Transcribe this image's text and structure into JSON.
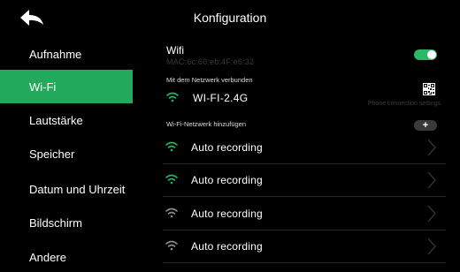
{
  "header": {
    "title": "Konfiguration",
    "back_icon": "back-arrow-icon"
  },
  "sidebar": {
    "items": [
      {
        "label": "Aufnahme",
        "active": false
      },
      {
        "label": "Wi-Fi",
        "active": true
      },
      {
        "label": "Lautstärke",
        "active": false
      },
      {
        "label": "Speicher",
        "active": false
      },
      {
        "label": "Datum und Uhrzeit",
        "active": false
      },
      {
        "label": "Bildschirm",
        "active": false
      },
      {
        "label": "Andere",
        "active": false
      }
    ]
  },
  "wifi": {
    "label": "Wifi",
    "mac": "MAC:6c:60:eb:4F:e6:32",
    "enabled": true
  },
  "connected": {
    "section_label": "Mit dem Netzwerk verbunden",
    "network_name": "WI-FI-2.4G",
    "phone_connection_label": "Phone connection settings"
  },
  "add_network": {
    "section_label": "Wi-Fi-Netzwerk hinzufügen",
    "button_label": "+"
  },
  "networks": [
    {
      "name": "Auto recording",
      "signal": "strong"
    },
    {
      "name": "Auto recording",
      "signal": "strong"
    },
    {
      "name": "Auto recording",
      "signal": "weak"
    },
    {
      "name": "Auto recording",
      "signal": "weak"
    }
  ],
  "colors": {
    "accent": "#22a95c",
    "toggle_on": "#2eb764",
    "wifi_strong": "#22b35e",
    "wifi_weak": "#8c8c8c"
  }
}
